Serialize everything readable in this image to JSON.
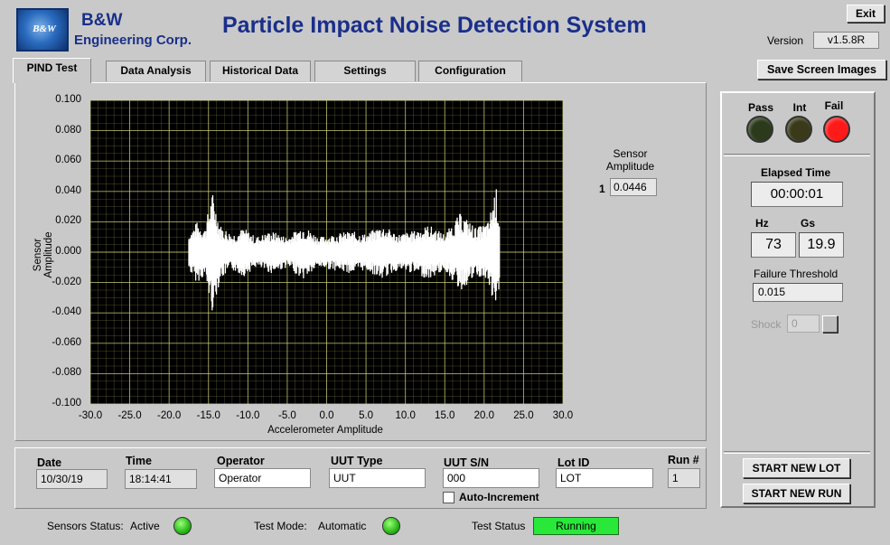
{
  "header": {
    "logo_text": "B&W",
    "company_line1": "B&W",
    "company_line2": "Engineering Corp.",
    "app_title": "Particle Impact Noise Detection System",
    "exit_label": "Exit",
    "version_label": "Version",
    "version_value": "v1.5.8R",
    "save_label": "Save Screen Images"
  },
  "tabs": [
    {
      "label": "PIND Test",
      "active": true
    },
    {
      "label": "Data Analysis",
      "active": false
    },
    {
      "label": "Historical Data",
      "active": false
    },
    {
      "label": "Settings",
      "active": false
    },
    {
      "label": "Configuration",
      "active": false
    }
  ],
  "chart_data": {
    "type": "line",
    "xlabel": "Accelerometer Amplitude",
    "ylabel": "Sensor Amplitude",
    "xlim": [
      -30,
      30
    ],
    "ylim": [
      -0.1,
      0.1
    ],
    "x_ticks": [
      "-30.0",
      "-25.0",
      "-20.0",
      "-15.0",
      "-10.0",
      "-5.0",
      "0.0",
      "5.0",
      "10.0",
      "15.0",
      "20.0",
      "25.0",
      "30.0"
    ],
    "y_ticks": [
      "0.100",
      "0.080",
      "0.060",
      "0.040",
      "0.020",
      "0.000",
      "-0.020",
      "-0.040",
      "-0.060",
      "-0.080",
      "-0.100"
    ],
    "grid": true,
    "background": "#000000",
    "grid_color": "#d8d878",
    "series_color": "#ffffff",
    "x_range": [
      -17.5,
      22
    ],
    "envelope": [
      [
        -17.5,
        0.012
      ],
      [
        -16.5,
        0.02
      ],
      [
        -15.5,
        0.016
      ],
      [
        -14.5,
        0.04
      ],
      [
        -13.5,
        0.018
      ],
      [
        -12,
        0.012
      ],
      [
        -10.5,
        0.016
      ],
      [
        -9,
        0.01
      ],
      [
        -7,
        0.014
      ],
      [
        -5,
        0.01
      ],
      [
        -3,
        0.018
      ],
      [
        -1,
        0.01
      ],
      [
        1,
        0.012
      ],
      [
        3,
        0.014
      ],
      [
        5,
        0.012
      ],
      [
        7,
        0.018
      ],
      [
        9,
        0.012
      ],
      [
        11,
        0.014
      ],
      [
        13,
        0.018
      ],
      [
        15,
        0.012
      ],
      [
        17,
        0.026
      ],
      [
        19,
        0.016
      ],
      [
        20.5,
        0.02
      ],
      [
        21.5,
        0.044
      ],
      [
        22,
        0.02
      ]
    ]
  },
  "sensor_readout": {
    "title_line1": "Sensor",
    "title_line2": "Amplitude",
    "index": "1",
    "value": "0.0446"
  },
  "indicators": {
    "pass_label": "Pass",
    "int_label": "Int",
    "fail_label": "Fail",
    "pass_color": "#2a3a1a",
    "int_color": "#3a3a1a",
    "fail_color": "#ff1a1a"
  },
  "right_panel": {
    "elapsed_label": "Elapsed Time",
    "elapsed_value": "00:00:01",
    "hz_label": "Hz",
    "hz_value": "73",
    "gs_label": "Gs",
    "gs_value": "19.9",
    "threshold_label": "Failure Threshold",
    "threshold_value": "0.015",
    "shock_label": "Shock",
    "shock_value": "0",
    "start_lot_label": "START NEW LOT",
    "start_run_label": "START NEW RUN"
  },
  "fields": {
    "date_label": "Date",
    "date_value": "10/30/19",
    "time_label": "Time",
    "time_value": "18:14:41",
    "operator_label": "Operator",
    "operator_value": "Operator",
    "uut_type_label": "UUT Type",
    "uut_type_value": "UUT",
    "uut_sn_label": "UUT S/N",
    "uut_sn_value": "000",
    "lot_label": "Lot ID",
    "lot_value": "LOT",
    "run_label": "Run #",
    "run_value": "1",
    "auto_increment_label": "Auto-Increment"
  },
  "status": {
    "sensors_label": "Sensors Status:",
    "sensors_value": "Active",
    "mode_label": "Test Mode:",
    "mode_value": "Automatic",
    "test_status_label": "Test Status",
    "test_status_value": "Running"
  }
}
